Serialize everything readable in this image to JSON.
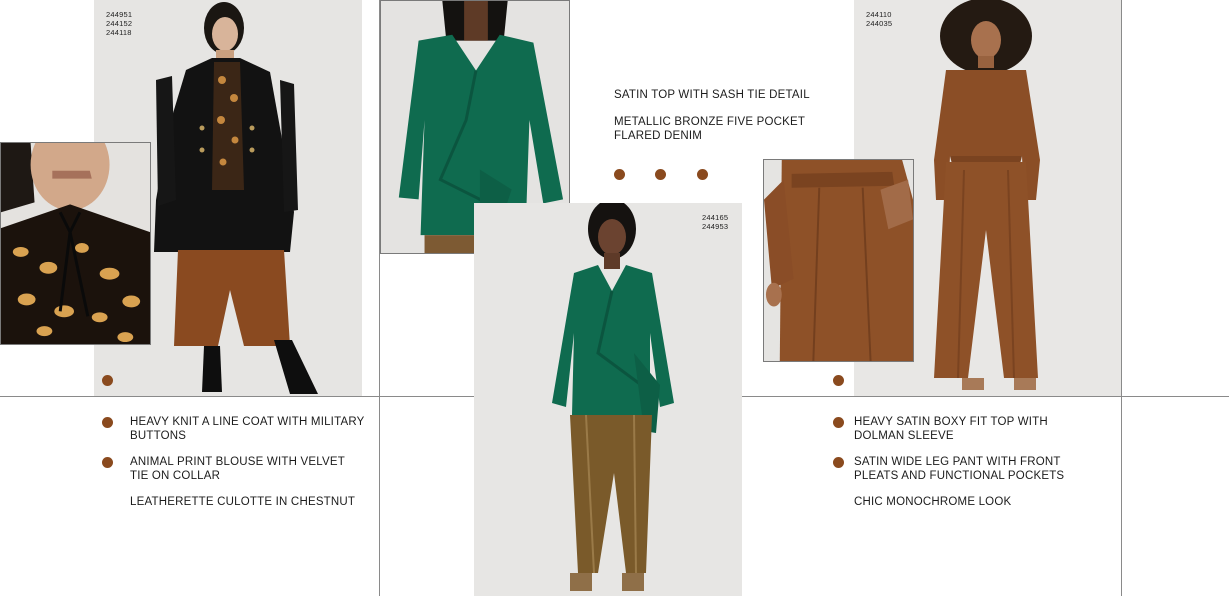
{
  "colors": {
    "accent_dot": "#8a4a1e",
    "background": "#ffffff",
    "rule_line": "#8a8a8a",
    "photo_backdrop": "#e9e9e9",
    "emerald": "#0f6b4f",
    "chestnut": "#8b4e26",
    "bronze": "#7a5a2a"
  },
  "look1": {
    "style_codes": [
      "244951",
      "244152",
      "244118"
    ],
    "items": [
      {
        "line1": "HEAVY KNIT A LINE COAT WITH MILITARY",
        "line2": "BUTTONS"
      },
      {
        "line1": "ANIMAL PRINT BLOUSE WITH VELVET",
        "line2": "TIE ON COLLAR"
      },
      {
        "line1": "LEATHERETTE CULOTTE IN CHESTNUT",
        "line2": ""
      }
    ]
  },
  "look2": {
    "style_codes": [
      "244165",
      "244953"
    ],
    "items": [
      {
        "line1": "SATIN TOP WITH SASH TIE DETAIL",
        "line2": ""
      },
      {
        "line1": "METALLIC BRONZE FIVE POCKET",
        "line2": "FLARED DENIM"
      }
    ]
  },
  "look3": {
    "style_codes": [
      "244110",
      "244035"
    ],
    "items": [
      {
        "line1": "HEAVY SATIN BOXY FIT TOP WITH",
        "line2": "DOLMAN SLEEVE"
      },
      {
        "line1": "SATIN WIDE LEG PANT WITH FRONT",
        "line2": "PLEATS AND FUNCTIONAL POCKETS"
      },
      {
        "line1": "CHIC MONOCHROME LOOK",
        "line2": ""
      }
    ]
  }
}
